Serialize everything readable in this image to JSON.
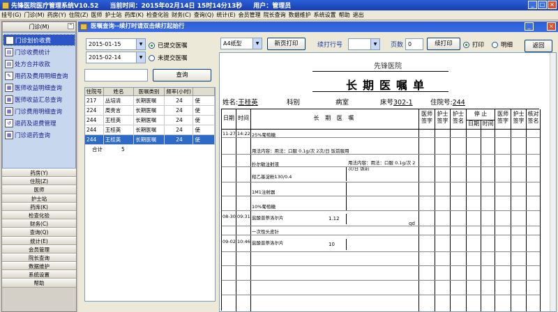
{
  "titlebar": {
    "app": "先锋医院医疗管理系统V10.52",
    "time": "当前时间：2015年02月14日  15时14分13秒",
    "user": "用户：管理员"
  },
  "menu": [
    "挂号(G)",
    "门诊(M)",
    "药房(Y)",
    "住院(Z)",
    "医师",
    "护士站",
    "药库(K)",
    "检查化验",
    "财务(C)",
    "查询(Q)",
    "统计(E)",
    "会员管理",
    "院长查询",
    "数据维护",
    "系统设置",
    "帮助",
    "退出"
  ],
  "left_panel": {
    "header": "门诊(M)",
    "items": [
      {
        "label": "门诊划价收费",
        "active": true
      },
      {
        "label": "门诊收费统计",
        "active": false
      },
      {
        "label": "处方合并收款",
        "active": false
      },
      {
        "label": "用药及费用明细查询",
        "active": false
      },
      {
        "label": "医师收益明细查询",
        "active": false
      },
      {
        "label": "医师收益汇总查询",
        "active": false
      },
      {
        "label": "门诊费用明细查询",
        "active": false
      },
      {
        "label": "退药及退费管理",
        "active": false
      },
      {
        "label": "门诊退药查询",
        "active": false
      }
    ],
    "sections": [
      "药房(Y)",
      "住院(Z)",
      "医师",
      "护士站",
      "药库(K)",
      "检查化验",
      "财务(C)",
      "查询(Q)",
      "统计(E)",
      "会员管理",
      "院长查询",
      "数据维护",
      "系统设置",
      "帮助"
    ]
  },
  "dialog": {
    "title": "医嘱查询--续打时请双击续打起始行",
    "date_from": "2015-01-15",
    "date_to": "2015-02-14",
    "radio_submitted": "已提交医嘱",
    "radio_unsubmitted": "未提交医嘱",
    "query_button": "查询",
    "paper": "A4纸型",
    "new_page_print": "新页打印",
    "continue_row_label": "续打行号",
    "page_label": "页数",
    "page_value": "0",
    "continue_print": "续打印",
    "radio_print": "打印",
    "radio_detail": "明细",
    "back_button": "返回"
  },
  "patient_table": {
    "columns": [
      "住院号",
      "姓名",
      "医嘱类别",
      "频率(小时)",
      ""
    ],
    "rows": [
      [
        "217",
        "丛培清",
        "长期医嘱",
        "24",
        "使"
      ],
      [
        "224",
        "周贵言",
        "长期医嘱",
        "24",
        "使"
      ],
      [
        "244",
        "王桂英",
        "长期医嘱",
        "24",
        "使"
      ],
      [
        "244",
        "王桂英",
        "长期医嘱",
        "24",
        "使"
      ],
      [
        "244",
        "王桂英",
        "长期医嘱",
        "24",
        "使"
      ]
    ],
    "selected_index": 4,
    "total_label": "合计",
    "total_value": "5"
  },
  "report": {
    "hospital": "先锋医院",
    "title": "长期医嘱单",
    "name_label": "姓名:",
    "name_value": "王桂英",
    "dept_label": "科别",
    "ward_label": "病室",
    "bed_label": "床号",
    "bed_value": "302-1",
    "inpatient_label": "住院号:",
    "inpatient_value": "244",
    "col_date": "日期",
    "col_time": "时间",
    "col_order": "长  期  医  嘱",
    "col_doc_sign": "医师签字",
    "col_nurse_sign": "护士签字",
    "col_nurse_sign2": "护士签名",
    "col_stop": "停   止",
    "col_stop_date": "日期",
    "col_stop_time": "时间",
    "col_doc_sign2": "医师签字",
    "col_nurse_sign3": "护士签字",
    "col_check": "核对签名",
    "entries": [
      {
        "date": "11-27",
        "time": "14:22",
        "text": "25%葡萄糖"
      },
      {
        "date": "",
        "time": "",
        "text": "用法内容：用法：口服 0.1g/次 2次/日 饭前服用"
      },
      {
        "date": "",
        "time": "",
        "text": "扑尔敏注射液"
      },
      {
        "date": "",
        "time": "",
        "text": "羟乙基淀粉130/0.4"
      },
      {
        "date": "",
        "time": "",
        "text": "1M1注射器"
      },
      {
        "date": "",
        "time": "",
        "text": "10%葡萄糖"
      },
      {
        "date": "08-30",
        "time": "09:31",
        "text": "盐酸普萘洛尔片"
      },
      {
        "date": "",
        "time": "",
        "text": "一次性头皮针"
      },
      {
        "date": "09-02",
        "time": "10:46",
        "text": "盐酸普萘洛尔片"
      }
    ],
    "usage_note": "用法内容：用法：口服 0.1g/次 2次/日 饭前",
    "qty1": "1.12",
    "qd": "qd",
    "qty2": "10"
  }
}
